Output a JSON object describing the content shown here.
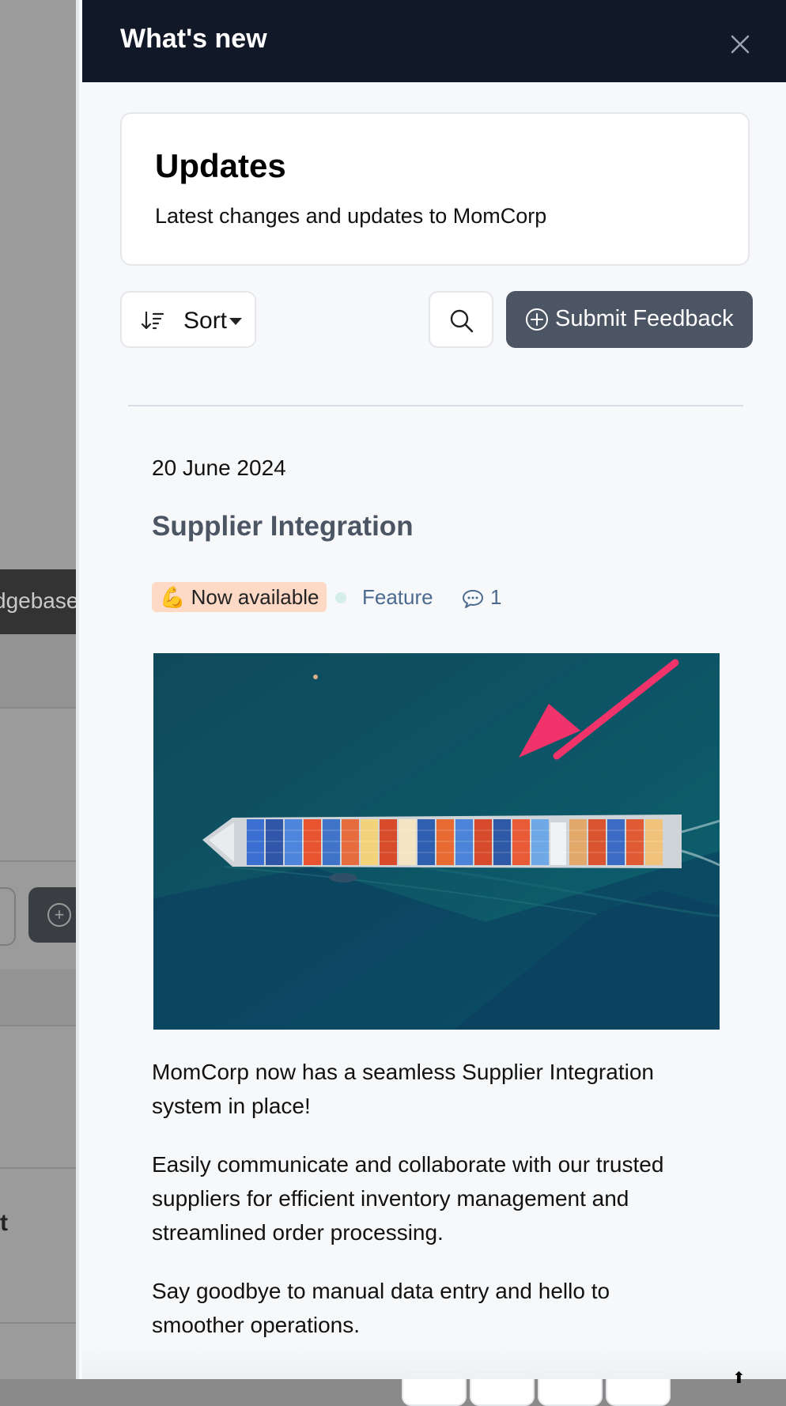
{
  "background": {
    "bar_text": "dgebase",
    "side_text": "t"
  },
  "panel": {
    "title": "What's new"
  },
  "card": {
    "heading": "Updates",
    "description": "Latest changes and updates to MomCorp"
  },
  "toolbar": {
    "sort_label": "Sort",
    "feedback_label": "Submit Feedback"
  },
  "post": {
    "date": "20 June 2024",
    "title": "Supplier Integration",
    "status_badge": "💪 Now available",
    "category": "Feature",
    "comment_count": "1",
    "image_icon": "annotated-photo-container-ship",
    "paragraphs": [
      "MomCorp now has a seamless Supplier Integration system in place!",
      "Easily communicate and collaborate with our trusted suppliers for efficient inventory management and streamlined order processing.",
      "Say goodbye to manual data entry and hello to smoother operations."
    ]
  },
  "colors": {
    "header_bg": "#111827",
    "button_dark": "#4b5563",
    "badge_bg": "#fdd9c6",
    "link_blue": "#4c6a8e",
    "arrow_pink": "#f0336a"
  }
}
